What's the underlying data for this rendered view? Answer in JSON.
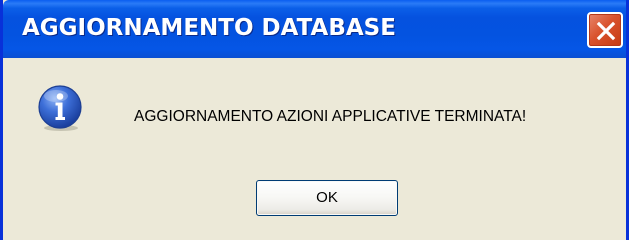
{
  "window": {
    "title": "AGGIORNAMENTO DATABASE",
    "close_icon": "close-icon"
  },
  "dialog": {
    "icon": "information-icon",
    "message": "AGGIORNAMENTO AZIONI APPLICATIVE TERMINATA!",
    "ok_label": "OK"
  },
  "colors": {
    "titlebar": "#0553e0",
    "body_bg": "#ece9d8",
    "close_button": "#d9532e",
    "icon_blue": "#2a5bc6"
  }
}
